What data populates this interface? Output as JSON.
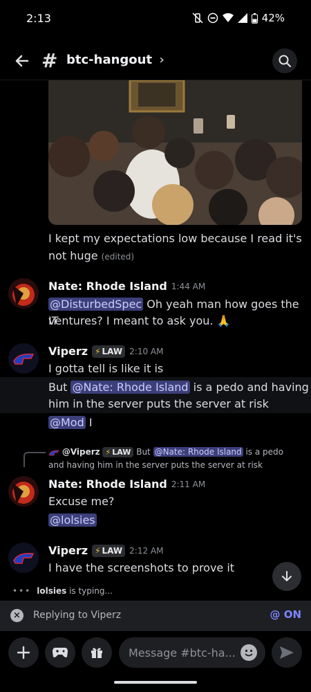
{
  "status_bar": {
    "time": "2:13",
    "battery": "42%"
  },
  "header": {
    "channel": "btc-hangout",
    "chevron": "›"
  },
  "messages": {
    "continued": {
      "line1": "I kept my expectations low because I read it's",
      "line2": "not huge",
      "edited": "(edited)"
    },
    "m1": {
      "author": "Nate: Rhode Island",
      "time": "1:44 AM",
      "mention": "@DisturbedSpec",
      "text1": " Oh yeah man how goes the IT",
      "text2": "ventures? I meant to ask you. 🙏"
    },
    "m2": {
      "author": "Viperz",
      "tag": "LAW",
      "time": "2:10 AM",
      "line1": "I gotta tell is like it is",
      "line2_pre": "But ",
      "line2_mention": "@Nate: Rhode Island",
      "line2_post": " is a pedo and having",
      "line3": "him in the server puts the server at risk",
      "line4_mention": "@Mod",
      "line4_post": " I"
    },
    "reply_ref": {
      "author": "@Viperz",
      "tag": "LAW",
      "pre": " But ",
      "mention": "@Nate: Rhode Island",
      "post": " is a pedo and having him in the server puts the server at risk"
    },
    "m3": {
      "author": "Nate: Rhode Island",
      "time": "2:11 AM",
      "line1": "Excuse me?",
      "mention": "@lolsies"
    },
    "m4": {
      "author": "Viperz",
      "tag": "LAW",
      "time": "2:12 AM",
      "line1": "I have the screenshots to prove it"
    }
  },
  "typing": {
    "user": "lolsies",
    "text": " is typing..."
  },
  "reply_bar": {
    "label": "Replying to Viperz",
    "on": "ON"
  },
  "composer": {
    "placeholder": "Message #btc-ha..."
  },
  "colors": {
    "mention_bg": "#3c3f7a",
    "accent": "#7b86ff",
    "bolt": "#f0c23c"
  }
}
